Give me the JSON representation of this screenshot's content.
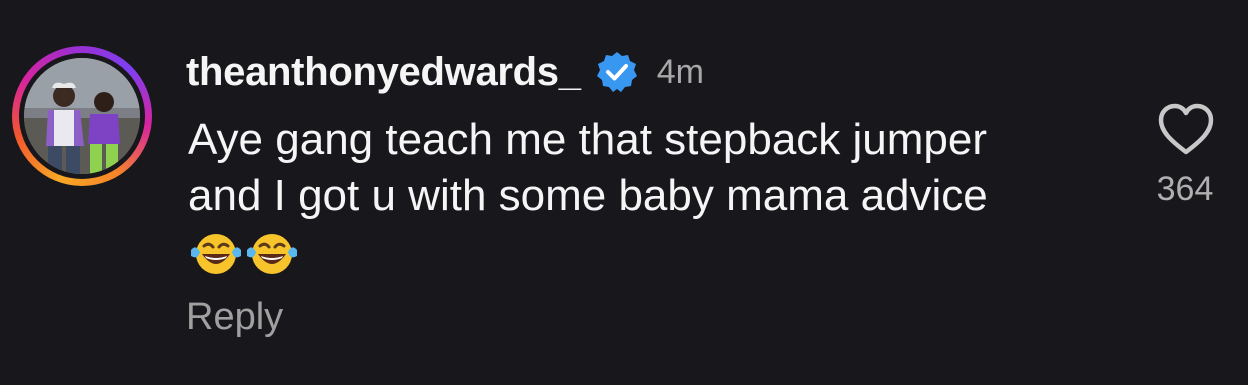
{
  "comment": {
    "username": "theanthonyedwards_",
    "verified": true,
    "timestamp": "4m",
    "text": "Aye gang teach me that stepback jumper and I got u with some baby mama advice",
    "emojis": [
      "face-with-tears-of-joy",
      "face-with-tears-of-joy"
    ],
    "reply_label": "Reply",
    "like_count": "364",
    "like_icon": "heart-outline-icon"
  },
  "colors": {
    "background": "#18171c",
    "text_primary": "#f5f5f5",
    "text_secondary": "#a8a8a8",
    "verified_badge": "#3897f0"
  }
}
